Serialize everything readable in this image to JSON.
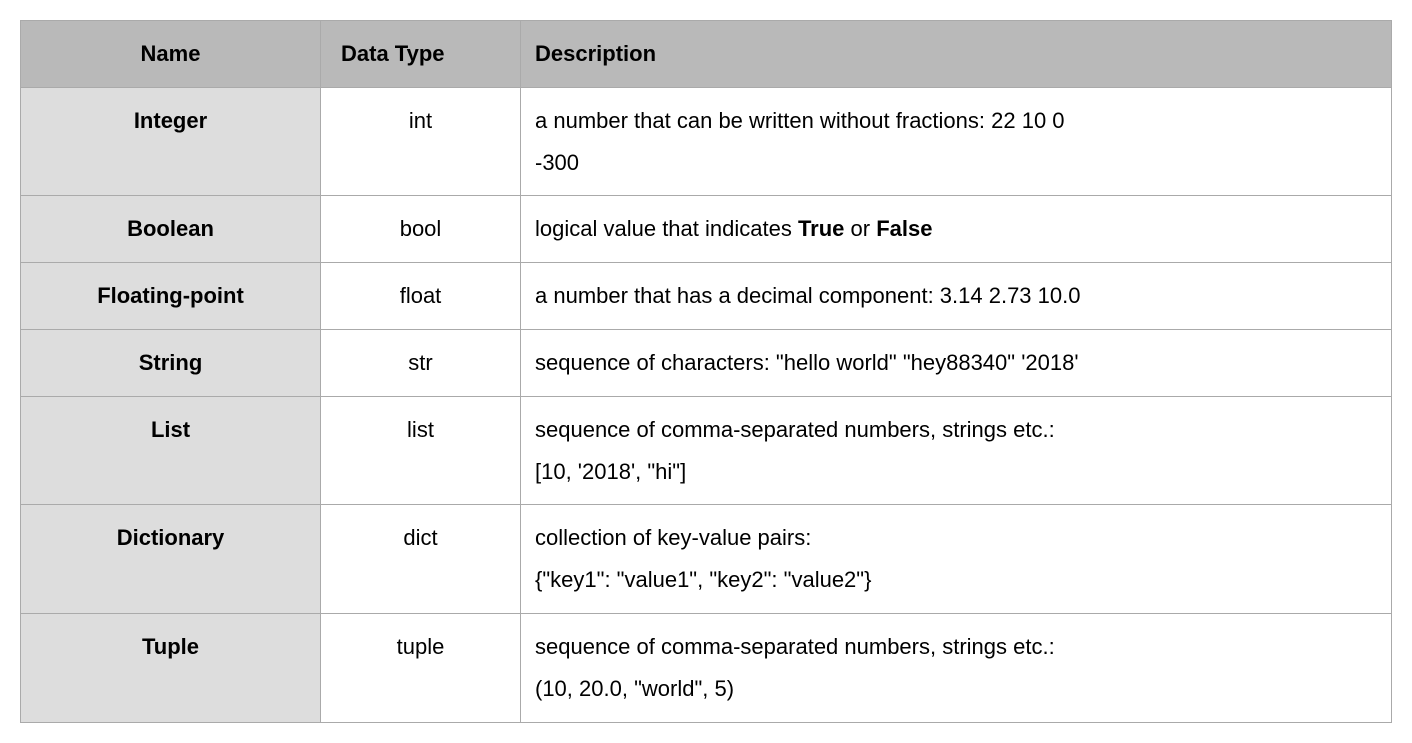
{
  "headers": {
    "name": "Name",
    "type": "Data Type",
    "desc": "Description"
  },
  "rows": [
    {
      "name": "Integer",
      "type": "int",
      "desc_line1_pre": "a number that can be written without fractions: 22  10  0",
      "desc_line2": "-300"
    },
    {
      "name": "Boolean",
      "type": "bool",
      "desc_line1_pre": "logical value that indicates ",
      "desc_bold1": "True",
      "desc_line1_mid": " or ",
      "desc_bold2": "False"
    },
    {
      "name": "Floating-point",
      "type": "float",
      "desc_line1_pre": "a number that has a decimal component: 3.14   2.73   10.0"
    },
    {
      "name": "String",
      "type": "str",
      "desc_line1_pre": "sequence of characters: \"hello world\"   \"hey88340\"   '2018'"
    },
    {
      "name": "List",
      "type": "list",
      "desc_line1_pre": "sequence of comma-separated numbers, strings etc.:",
      "desc_line2": "[10, '2018', \"hi\"]"
    },
    {
      "name": "Dictionary",
      "type": "dict",
      "desc_line1_pre": "collection of key-value pairs:",
      "desc_line2": "{\"key1\": \"value1\", \"key2\": \"value2\"}"
    },
    {
      "name": "Tuple",
      "type": "tuple",
      "desc_line1_pre": "sequence of comma-separated numbers, strings etc.:",
      "desc_line2": "(10, 20.0, \"world\", 5)"
    }
  ]
}
